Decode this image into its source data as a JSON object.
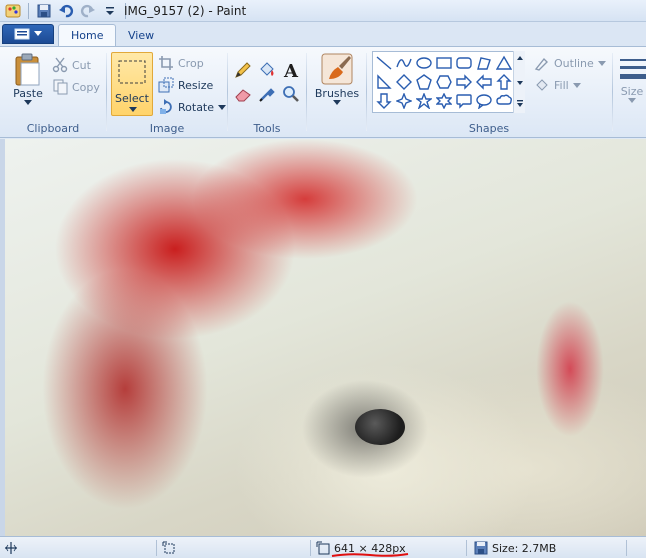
{
  "window": {
    "title": "IMG_9157 (2) - Paint"
  },
  "tabs": [
    {
      "label": "Home"
    },
    {
      "label": "View"
    }
  ],
  "ribbon": {
    "clipboard": {
      "label": "Clipboard",
      "paste": "Paste",
      "cut": "Cut",
      "copy": "Copy"
    },
    "image": {
      "label": "Image",
      "select": "Select",
      "crop": "Crop",
      "resize": "Resize",
      "rotate": "Rotate"
    },
    "tools": {
      "label": "Tools"
    },
    "brushes": {
      "label": "Brushes"
    },
    "shapes": {
      "label": "Shapes",
      "outline": "Outline",
      "fill": "Fill"
    },
    "size": {
      "label": "Size"
    }
  },
  "status": {
    "dimensions": "641 × 428px",
    "size": "Size: 2.7MB"
  },
  "colors": {
    "accent": "#1c4a94",
    "select_highlight": "#ffd36b",
    "annotation": "#e01010"
  }
}
